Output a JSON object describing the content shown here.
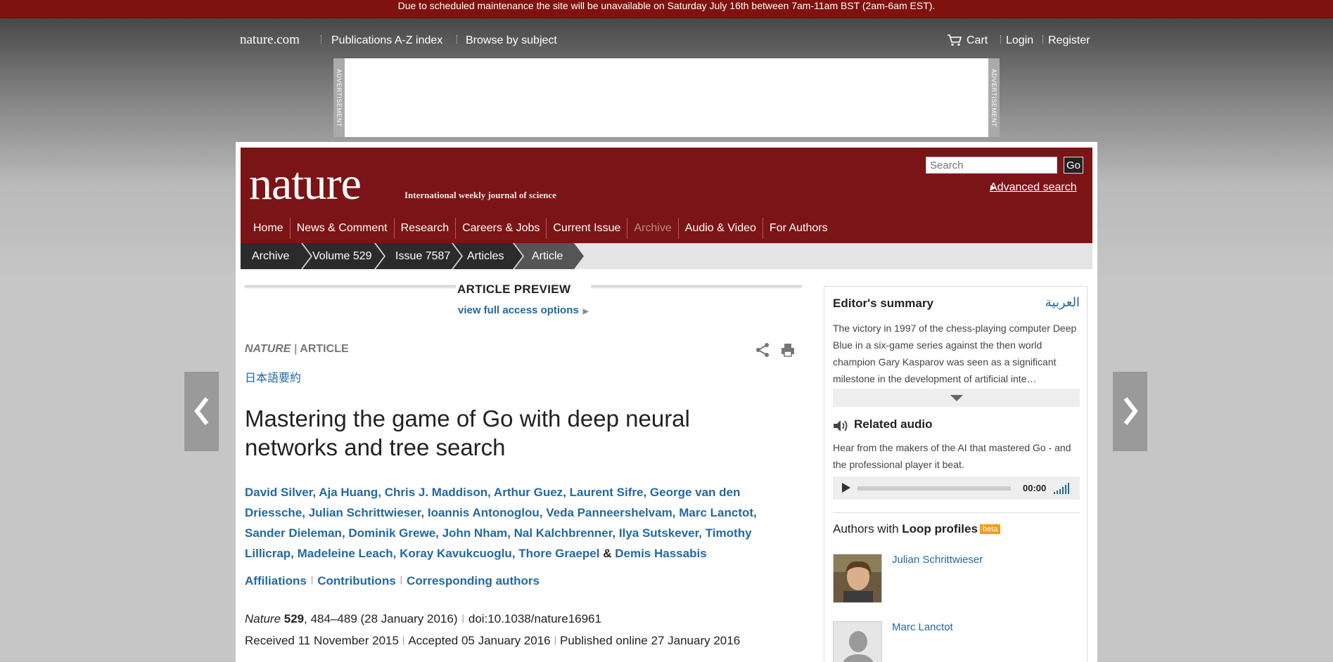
{
  "maintenance": "Due to scheduled maintenance the site will be unavailable on Saturday July 16th between 7am-11am BST (2am-6am EST).",
  "topbar": {
    "brand": "nature.com",
    "links": [
      "Publications A-Z index",
      "Browse by subject"
    ],
    "cart": "Cart",
    "login": "Login",
    "register": "Register"
  },
  "ad": {
    "label": "ADVERTISEMENT"
  },
  "masthead": {
    "logo": "nature",
    "tagline": "International weekly journal of science",
    "search_placeholder": "Search",
    "search_go": "Go",
    "advanced_search": "Advanced search"
  },
  "nav": [
    "Home",
    "News & Comment",
    "Research",
    "Careers & Jobs",
    "Current Issue",
    "Archive",
    "Audio & Video",
    "For Authors"
  ],
  "breadcrumb": [
    "Archive",
    "Volume 529",
    "Issue 7587",
    "Articles",
    "Article"
  ],
  "preview": {
    "title": "ARTICLE PREVIEW",
    "link": "view full access options"
  },
  "article": {
    "journal": "NATURE",
    "type": "ARTICLE",
    "jp_link": "日本語要約",
    "title": "Mastering the game of Go with deep neural networks and tree search",
    "authors_line1": "David Silver, Aja Huang, Chris J. Maddison, Arthur Guez, Laurent Sifre, George van den",
    "authors_line2": "Driessche, Julian Schrittwieser, Ioannis Antonoglou, Veda Panneershelvam, Marc Lanctot,",
    "authors_line3": "Sander Dieleman, Dominik Grewe, John Nham, Nal Kalchbrenner, Ilya Sutskever, Timothy",
    "authors_line4a": "Lillicrap, Madeleine Leach, Koray Kavukcuoglu, Thore Graepel",
    "authors_amp": "&",
    "authors_line4b": "Demis Hassabis",
    "affiliations": "Affiliations",
    "contributions": "Contributions",
    "corresponding": "Corresponding authors",
    "cite_journal": "Nature",
    "cite_volume": "529",
    "cite_pages": ", 484–489",
    "cite_date": "(28 January 2016)",
    "doi": "doi:10.1038/nature16961",
    "received_label": "Received",
    "received": "11 November 2015",
    "accepted_label": "Accepted",
    "accepted": "05 January 2016",
    "published_label": "Published online",
    "published": "27 January 2016"
  },
  "sidebar": {
    "editors_summary": "Editor's summary",
    "arabic": "العربية",
    "summary_text": "The victory in 1997 of the chess-playing computer Deep Blue in a six-game series against the then world champion Gary Kasparov was seen as a significant milestone in the development of artificial inte…",
    "related_audio": "Related audio",
    "audio_text": "Hear from the makers of the AI that mastered Go - and the professional player it beat.",
    "audio_time": "00:00",
    "loop_prefix": "Authors with",
    "loop_bold": "Loop profiles",
    "beta": "beta",
    "loop_people": [
      "Julian Schrittwieser",
      "Marc Lanctot"
    ]
  }
}
